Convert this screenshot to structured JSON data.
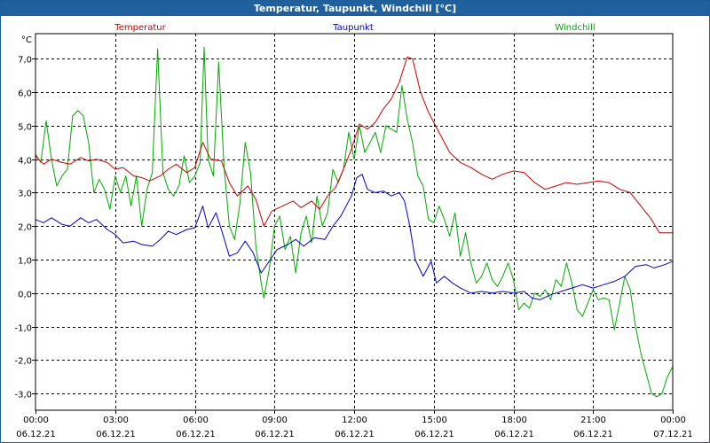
{
  "window": {
    "title": "Temperatur, Taupunkt, Windchill [°C]"
  },
  "colors": {
    "background": "#ffffff",
    "titlebar": "#20609f",
    "grid": "#000000"
  },
  "chart_data": {
    "type": "line",
    "title": "Temperatur, Taupunkt, Windchill [°C]",
    "ylabel": "°C",
    "ylim": [
      -3.5,
      7.75
    ],
    "xlim": [
      0,
      24
    ],
    "grid": true,
    "legend_placement": "top",
    "y_ticks": [
      {
        "value": 7.0,
        "label": "7,0"
      },
      {
        "value": 6.0,
        "label": "6,0"
      },
      {
        "value": 5.0,
        "label": "5,0"
      },
      {
        "value": 4.0,
        "label": "4,0"
      },
      {
        "value": 3.0,
        "label": "3,0"
      },
      {
        "value": 2.0,
        "label": "2,0"
      },
      {
        "value": 1.0,
        "label": "1,0"
      },
      {
        "value": 0.0,
        "label": "0,0"
      },
      {
        "value": -1.0,
        "label": "-1,0"
      },
      {
        "value": -2.0,
        "label": "-2,0"
      },
      {
        "value": -3.0,
        "label": "-3,0"
      }
    ],
    "x_ticks": [
      {
        "value": 0,
        "time": "00:00",
        "date": "06.12.21"
      },
      {
        "value": 3,
        "time": "03:00",
        "date": "06.12.21"
      },
      {
        "value": 6,
        "time": "06:00",
        "date": "06.12.21"
      },
      {
        "value": 9,
        "time": "09:00",
        "date": "06.12.21"
      },
      {
        "value": 12,
        "time": "12:00",
        "date": "06.12.21"
      },
      {
        "value": 15,
        "time": "15:00",
        "date": "06.12.21"
      },
      {
        "value": 18,
        "time": "18:00",
        "date": "06.12.21"
      },
      {
        "value": 21,
        "time": "21:00",
        "date": "06.12.21"
      },
      {
        "value": 24,
        "time": "00:00",
        "date": "07.12.21"
      }
    ],
    "series": [
      {
        "name": "Temperatur",
        "color": "#cc0000",
        "points": [
          [
            0.0,
            4.1
          ],
          [
            0.3,
            3.85
          ],
          [
            0.6,
            4.0
          ],
          [
            1.0,
            3.9
          ],
          [
            1.3,
            3.85
          ],
          [
            1.7,
            4.05
          ],
          [
            2.0,
            3.95
          ],
          [
            2.3,
            4.0
          ],
          [
            2.7,
            3.9
          ],
          [
            3.0,
            3.7
          ],
          [
            3.3,
            3.75
          ],
          [
            3.7,
            3.5
          ],
          [
            4.0,
            3.45
          ],
          [
            4.3,
            3.35
          ],
          [
            4.7,
            3.5
          ],
          [
            5.0,
            3.7
          ],
          [
            5.3,
            3.85
          ],
          [
            5.7,
            3.6
          ],
          [
            6.0,
            3.75
          ],
          [
            6.3,
            4.5
          ],
          [
            6.6,
            4.0
          ],
          [
            7.0,
            3.95
          ],
          [
            7.3,
            3.3
          ],
          [
            7.6,
            2.9
          ],
          [
            8.0,
            3.2
          ],
          [
            8.3,
            2.8
          ],
          [
            8.6,
            2.0
          ],
          [
            8.9,
            2.45
          ],
          [
            9.3,
            2.6
          ],
          [
            9.7,
            2.75
          ],
          [
            10.0,
            2.55
          ],
          [
            10.4,
            2.75
          ],
          [
            10.7,
            2.5
          ],
          [
            11.0,
            2.9
          ],
          [
            11.3,
            3.15
          ],
          [
            11.6,
            3.7
          ],
          [
            11.9,
            4.3
          ],
          [
            12.2,
            5.05
          ],
          [
            12.5,
            4.9
          ],
          [
            12.8,
            5.1
          ],
          [
            13.1,
            5.5
          ],
          [
            13.4,
            5.8
          ],
          [
            13.7,
            6.3
          ],
          [
            14.0,
            7.05
          ],
          [
            14.2,
            7.0
          ],
          [
            14.5,
            6.0
          ],
          [
            14.8,
            5.4
          ],
          [
            15.2,
            4.8
          ],
          [
            15.6,
            4.2
          ],
          [
            16.0,
            3.9
          ],
          [
            16.4,
            3.75
          ],
          [
            16.8,
            3.55
          ],
          [
            17.2,
            3.4
          ],
          [
            17.6,
            3.55
          ],
          [
            18.0,
            3.65
          ],
          [
            18.4,
            3.6
          ],
          [
            18.8,
            3.3
          ],
          [
            19.2,
            3.1
          ],
          [
            19.6,
            3.2
          ],
          [
            20.0,
            3.3
          ],
          [
            20.4,
            3.25
          ],
          [
            20.8,
            3.3
          ],
          [
            21.2,
            3.35
          ],
          [
            21.6,
            3.3
          ],
          [
            22.0,
            3.1
          ],
          [
            22.4,
            3.0
          ],
          [
            22.8,
            2.6
          ],
          [
            23.2,
            2.2
          ],
          [
            23.5,
            1.8
          ],
          [
            24.0,
            1.8
          ]
        ]
      },
      {
        "name": "Taupunkt",
        "color": "#0000cc",
        "points": [
          [
            0.0,
            2.2
          ],
          [
            0.3,
            2.1
          ],
          [
            0.6,
            2.25
          ],
          [
            1.0,
            2.05
          ],
          [
            1.3,
            2.0
          ],
          [
            1.7,
            2.25
          ],
          [
            2.0,
            2.1
          ],
          [
            2.3,
            2.2
          ],
          [
            2.7,
            1.9
          ],
          [
            3.0,
            1.75
          ],
          [
            3.3,
            1.5
          ],
          [
            3.7,
            1.55
          ],
          [
            4.0,
            1.45
          ],
          [
            4.4,
            1.4
          ],
          [
            4.7,
            1.6
          ],
          [
            5.0,
            1.85
          ],
          [
            5.3,
            1.75
          ],
          [
            5.7,
            1.9
          ],
          [
            6.0,
            1.95
          ],
          [
            6.3,
            2.6
          ],
          [
            6.5,
            1.95
          ],
          [
            6.8,
            2.4
          ],
          [
            7.0,
            1.9
          ],
          [
            7.3,
            1.1
          ],
          [
            7.6,
            1.2
          ],
          [
            7.9,
            1.55
          ],
          [
            8.2,
            1.2
          ],
          [
            8.5,
            0.6
          ],
          [
            8.8,
            0.95
          ],
          [
            9.1,
            1.3
          ],
          [
            9.5,
            1.45
          ],
          [
            9.8,
            1.6
          ],
          [
            10.1,
            1.4
          ],
          [
            10.5,
            1.65
          ],
          [
            10.9,
            1.6
          ],
          [
            11.2,
            2.0
          ],
          [
            11.5,
            2.3
          ],
          [
            11.9,
            2.9
          ],
          [
            12.1,
            3.45
          ],
          [
            12.3,
            3.55
          ],
          [
            12.5,
            3.1
          ],
          [
            12.8,
            3.0
          ],
          [
            13.1,
            3.05
          ],
          [
            13.4,
            2.9
          ],
          [
            13.7,
            3.0
          ],
          [
            13.9,
            2.75
          ],
          [
            14.1,
            2.0
          ],
          [
            14.3,
            1.0
          ],
          [
            14.6,
            0.5
          ],
          [
            14.9,
            0.95
          ],
          [
            15.1,
            0.3
          ],
          [
            15.4,
            0.5
          ],
          [
            15.7,
            0.3
          ],
          [
            16.0,
            0.15
          ],
          [
            16.4,
            0.0
          ],
          [
            16.8,
            0.05
          ],
          [
            17.2,
            0.0
          ],
          [
            17.6,
            0.05
          ],
          [
            18.0,
            0.0
          ],
          [
            18.4,
            0.05
          ],
          [
            18.7,
            -0.15
          ],
          [
            19.0,
            -0.2
          ],
          [
            19.4,
            -0.05
          ],
          [
            19.8,
            0.05
          ],
          [
            20.2,
            0.15
          ],
          [
            20.6,
            0.25
          ],
          [
            21.0,
            0.15
          ],
          [
            21.4,
            0.25
          ],
          [
            21.8,
            0.35
          ],
          [
            22.2,
            0.5
          ],
          [
            22.6,
            0.8
          ],
          [
            23.0,
            0.85
          ],
          [
            23.3,
            0.75
          ],
          [
            23.7,
            0.85
          ],
          [
            24.0,
            0.95
          ]
        ]
      },
      {
        "name": "Windchill",
        "color": "#00aa00",
        "points": [
          [
            0.0,
            4.15
          ],
          [
            0.2,
            3.9
          ],
          [
            0.4,
            5.15
          ],
          [
            0.6,
            4.0
          ],
          [
            0.8,
            3.2
          ],
          [
            1.0,
            3.5
          ],
          [
            1.2,
            3.7
          ],
          [
            1.4,
            5.3
          ],
          [
            1.6,
            5.45
          ],
          [
            1.8,
            5.3
          ],
          [
            2.0,
            4.5
          ],
          [
            2.2,
            3.0
          ],
          [
            2.4,
            3.4
          ],
          [
            2.6,
            3.1
          ],
          [
            2.8,
            2.5
          ],
          [
            3.0,
            3.5
          ],
          [
            3.2,
            3.0
          ],
          [
            3.4,
            3.5
          ],
          [
            3.6,
            2.6
          ],
          [
            3.8,
            3.5
          ],
          [
            4.0,
            2.0
          ],
          [
            4.2,
            3.1
          ],
          [
            4.4,
            3.6
          ],
          [
            4.6,
            7.3
          ],
          [
            4.8,
            3.6
          ],
          [
            5.0,
            3.1
          ],
          [
            5.2,
            2.9
          ],
          [
            5.4,
            3.2
          ],
          [
            5.6,
            4.1
          ],
          [
            5.8,
            3.3
          ],
          [
            6.0,
            3.5
          ],
          [
            6.2,
            3.9
          ],
          [
            6.35,
            7.35
          ],
          [
            6.5,
            4.0
          ],
          [
            6.7,
            3.5
          ],
          [
            6.9,
            6.9
          ],
          [
            7.1,
            3.8
          ],
          [
            7.3,
            2.0
          ],
          [
            7.5,
            1.6
          ],
          [
            7.7,
            2.7
          ],
          [
            7.9,
            4.5
          ],
          [
            8.1,
            3.6
          ],
          [
            8.3,
            1.4
          ],
          [
            8.5,
            0.3
          ],
          [
            8.6,
            -0.15
          ],
          [
            8.8,
            0.7
          ],
          [
            9.0,
            2.0
          ],
          [
            9.2,
            2.3
          ],
          [
            9.4,
            1.3
          ],
          [
            9.6,
            1.7
          ],
          [
            9.8,
            0.6
          ],
          [
            10.0,
            1.8
          ],
          [
            10.2,
            2.3
          ],
          [
            10.4,
            1.5
          ],
          [
            10.6,
            2.9
          ],
          [
            10.8,
            2.0
          ],
          [
            11.0,
            2.4
          ],
          [
            11.2,
            3.7
          ],
          [
            11.4,
            3.3
          ],
          [
            11.6,
            3.7
          ],
          [
            11.8,
            4.8
          ],
          [
            12.0,
            4.0
          ],
          [
            12.2,
            5.0
          ],
          [
            12.4,
            4.2
          ],
          [
            12.6,
            4.5
          ],
          [
            12.8,
            4.8
          ],
          [
            13.0,
            4.2
          ],
          [
            13.2,
            5.0
          ],
          [
            13.4,
            4.9
          ],
          [
            13.6,
            4.8
          ],
          [
            13.8,
            6.2
          ],
          [
            14.0,
            5.2
          ],
          [
            14.2,
            4.5
          ],
          [
            14.4,
            3.5
          ],
          [
            14.6,
            3.2
          ],
          [
            14.8,
            2.2
          ],
          [
            15.0,
            2.1
          ],
          [
            15.2,
            2.6
          ],
          [
            15.4,
            2.2
          ],
          [
            15.6,
            1.7
          ],
          [
            15.8,
            2.4
          ],
          [
            16.0,
            1.1
          ],
          [
            16.2,
            1.8
          ],
          [
            16.4,
            0.9
          ],
          [
            16.6,
            0.3
          ],
          [
            16.8,
            0.5
          ],
          [
            17.0,
            0.9
          ],
          [
            17.2,
            0.4
          ],
          [
            17.4,
            0.2
          ],
          [
            17.6,
            0.5
          ],
          [
            17.8,
            0.9
          ],
          [
            18.0,
            0.4
          ],
          [
            18.2,
            -0.5
          ],
          [
            18.4,
            -0.3
          ],
          [
            18.6,
            -0.45
          ],
          [
            18.8,
            0.0
          ],
          [
            19.0,
            -0.1
          ],
          [
            19.2,
            0.1
          ],
          [
            19.4,
            -0.2
          ],
          [
            19.6,
            0.4
          ],
          [
            19.8,
            0.2
          ],
          [
            20.0,
            0.9
          ],
          [
            20.2,
            0.3
          ],
          [
            20.4,
            -0.5
          ],
          [
            20.6,
            -0.7
          ],
          [
            20.8,
            -0.3
          ],
          [
            21.0,
            0.1
          ],
          [
            21.2,
            -0.2
          ],
          [
            21.4,
            -0.15
          ],
          [
            21.6,
            -0.2
          ],
          [
            21.8,
            -1.1
          ],
          [
            22.0,
            -0.3
          ],
          [
            22.2,
            0.5
          ],
          [
            22.4,
            0.1
          ],
          [
            22.6,
            -1.0
          ],
          [
            22.8,
            -1.8
          ],
          [
            23.0,
            -2.4
          ],
          [
            23.2,
            -3.0
          ],
          [
            23.4,
            -3.1
          ],
          [
            23.6,
            -3.0
          ],
          [
            23.8,
            -2.5
          ],
          [
            24.0,
            -2.2
          ]
        ]
      }
    ]
  }
}
